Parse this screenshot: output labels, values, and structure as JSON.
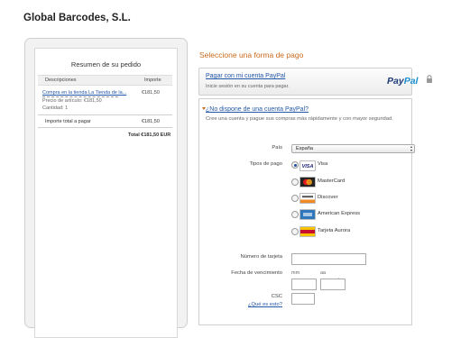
{
  "merchant": {
    "name": "Global Barcodes, S.L."
  },
  "summary": {
    "title": "Resumen de su pedido",
    "col_description": "Descripciones",
    "col_amount": "Importe",
    "item_name": "Compra en la tienda La Tienda de la...",
    "item_unit_price": "Precio de artículo: €181,50",
    "item_quantity": "Cantidad: 1",
    "item_amount": "€181,50",
    "total_label": "Importe total a pagar",
    "total_amount": "€181,50",
    "grand_total": "Total €181,50 EUR"
  },
  "payment": {
    "section_title": "Seleccione una forma de pago",
    "paypal_link": "Pagar con mi cuenta PayPal",
    "paypal_sub": "Inicie sesión en su cuenta para pagar.",
    "paypal_logo_1": "Pay",
    "paypal_logo_2": "Pal",
    "guest_title": "¿No dispone de una cuenta PayPal?",
    "guest_sub": "Cree una cuenta y pague sus compras más rápidamente y con mayor seguridad."
  },
  "form": {
    "country_label": "País",
    "country_value": "España",
    "card_type_label": "Tipos de pago",
    "cards": [
      {
        "name": "Visa",
        "icon": "visa-icon",
        "selected": true
      },
      {
        "name": "MasterCard",
        "icon": "mastercard-icon",
        "selected": false
      },
      {
        "name": "Discover",
        "icon": "discover-icon",
        "selected": false
      },
      {
        "name": "American Express",
        "icon": "amex-icon",
        "selected": false
      },
      {
        "name": "Tarjeta Aurora",
        "icon": "aurora-icon",
        "selected": false
      }
    ],
    "card_number_label": "Número de tarjeta",
    "card_number_value": "",
    "expiry_label": "Fecha de vencimiento",
    "expiry_month_hint": "mm",
    "expiry_year_hint": "aa",
    "expiry_separator": "/",
    "csc_label": "CSC",
    "csc_help": "¿Qué es esto?"
  },
  "colors": {
    "accent": "#c86a1d",
    "link": "#2358a8",
    "paypal_dark": "#1d3c78",
    "paypal_light": "#1e8fd0"
  }
}
